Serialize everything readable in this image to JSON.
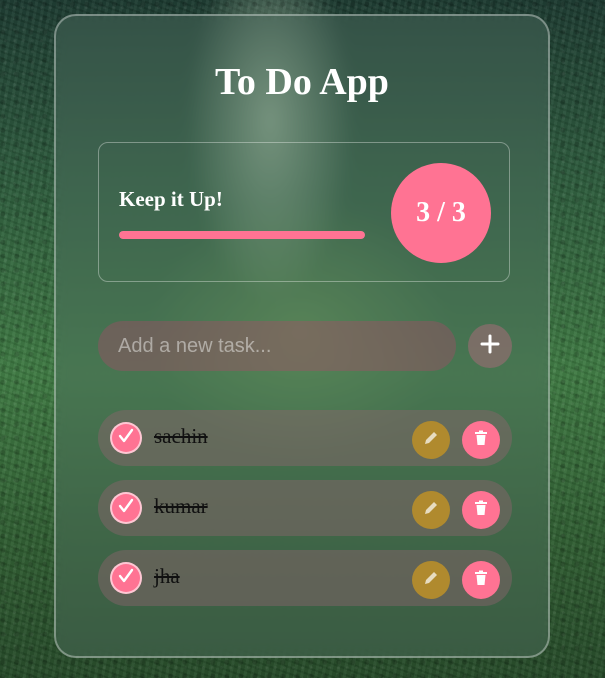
{
  "app": {
    "title": "To Do App"
  },
  "stats": {
    "message": "Keep it Up!",
    "counter": "3 / 3",
    "completed": 3,
    "total": 3,
    "progress": 1.0
  },
  "input": {
    "placeholder": "Add a new task...",
    "value": "",
    "add_button_icon": "plus-icon"
  },
  "tasks": [
    {
      "text": "sachin",
      "completed": true
    },
    {
      "text": "kumar",
      "completed": true
    },
    {
      "text": "jha",
      "completed": true
    }
  ],
  "icons": {
    "check": "check-icon",
    "edit": "pencil-icon",
    "delete": "trash-icon"
  },
  "colors": {
    "accent": "#ff7393",
    "edit": "#b08a2e"
  }
}
